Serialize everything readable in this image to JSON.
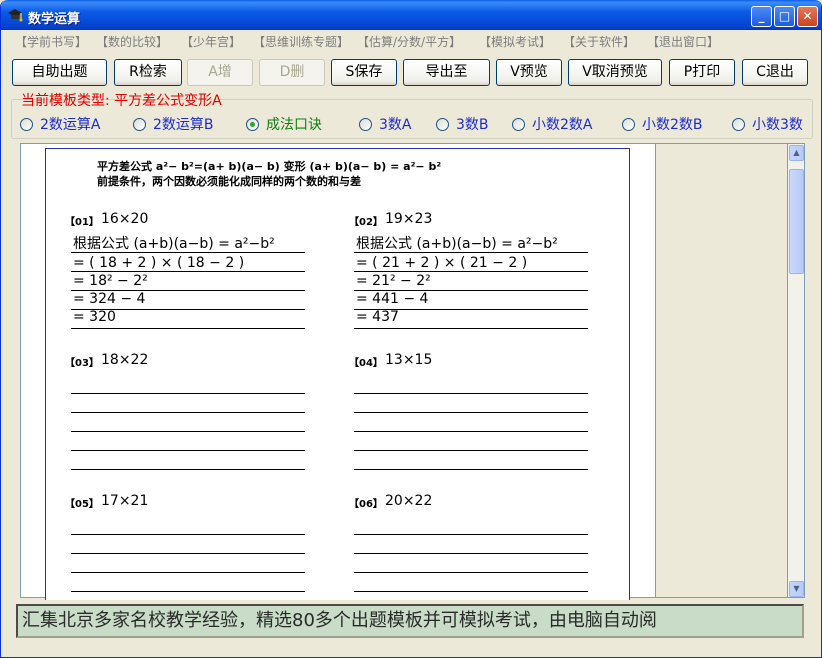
{
  "window": {
    "title": "数学运算",
    "min_glyph": "_",
    "max_glyph": "□",
    "close_glyph": "✕"
  },
  "menu": [
    "【学前书写】",
    "【数的比较】",
    "【少年宫】",
    "【思维训练专题】",
    "【估算/分数/平方】",
    "【模拟考试】",
    "【关于软件】",
    "【退出窗口】"
  ],
  "toolbar": [
    "自助出题",
    "R检索",
    "A增",
    "D删",
    "S保存",
    "导出至",
    "V预览",
    "V取消预览",
    "P打印",
    "C退出"
  ],
  "mode_label": "当前模板类型: 平方差公式变形A",
  "radios": [
    {
      "label": "2数运算A",
      "checked": false
    },
    {
      "label": "2数运算B",
      "checked": false
    },
    {
      "label": "成法口诀",
      "checked": true
    },
    {
      "label": "3数A",
      "checked": false
    },
    {
      "label": "3数B",
      "checked": false
    },
    {
      "label": "小数2数A",
      "checked": false
    },
    {
      "label": "小数2数B",
      "checked": false
    },
    {
      "label": "小数3数",
      "checked": false
    }
  ],
  "document": {
    "heading": "平方差公式 a²− b²=(a+ b)(a− b) 变形 (a+ b)(a− b) = a²− b²",
    "subheading": "前提条件，两个因数必须能化成同样的两个数的和与差",
    "questions": [
      {
        "num": "【01】",
        "expr": "16×20",
        "steps": [
          "根据公式 (a+b)(a−b) = a²−b²",
          "= ( 18 + 2 ) × ( 18 − 2 )",
          "= 18² − 2²",
          "= 324 − 4",
          "= 320"
        ]
      },
      {
        "num": "【02】",
        "expr": "19×23",
        "steps": [
          "根据公式 (a+b)(a−b) = a²−b²",
          "= ( 21 + 2 ) × ( 21 − 2 )",
          "= 21² − 2²",
          "= 441 − 4",
          "= 437"
        ]
      },
      {
        "num": "【03】",
        "expr": "18×22"
      },
      {
        "num": "【04】",
        "expr": "13×15"
      },
      {
        "num": "【05】",
        "expr": "17×21"
      },
      {
        "num": "【06】",
        "expr": "20×22"
      }
    ]
  },
  "status": "汇集北京多家名校教学经验，精选80多个出题模板并可模拟考试，由电脑自动阅"
}
